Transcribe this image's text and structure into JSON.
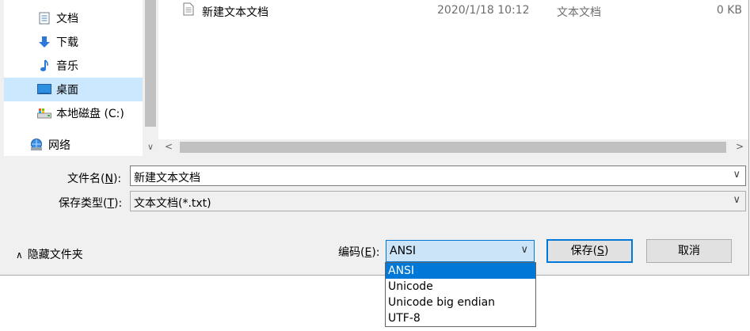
{
  "nav": {
    "items": [
      {
        "label": "文档",
        "icon": "documents-icon"
      },
      {
        "label": "下载",
        "icon": "downloads-icon"
      },
      {
        "label": "音乐",
        "icon": "music-icon"
      },
      {
        "label": "桌面",
        "icon": "desktop-icon",
        "selected": true
      },
      {
        "label": "本地磁盘 (C:)",
        "icon": "drive-icon"
      },
      {
        "label": "网络",
        "icon": "network-icon"
      }
    ]
  },
  "files": [
    {
      "name": "新建文本文档",
      "date": "2020/1/18 10:12",
      "type": "文本文档",
      "size": "0 KB",
      "icon": "text-file-icon"
    }
  ],
  "form": {
    "filename_label_pre": "文件名(",
    "filename_label_key": "N",
    "filename_label_post": "):",
    "filename_value": "新建文本文档",
    "filetype_label_pre": "保存类型(",
    "filetype_label_key": "T",
    "filetype_label_post": "):",
    "filetype_value": "文本文档(*.txt)",
    "encoding_label_pre": "编码(",
    "encoding_label_key": "E",
    "encoding_label_post": "):",
    "encoding_value": "ANSI",
    "encoding_options": [
      "ANSI",
      "Unicode",
      "Unicode big endian",
      "UTF-8"
    ],
    "hide_folders_label": "隐藏文件夹",
    "save_pre": "保存(",
    "save_key": "S",
    "save_post": ")",
    "cancel_label": "取消"
  },
  "colors": {
    "accent": "#0078d7",
    "selection": "#cce8ff"
  }
}
